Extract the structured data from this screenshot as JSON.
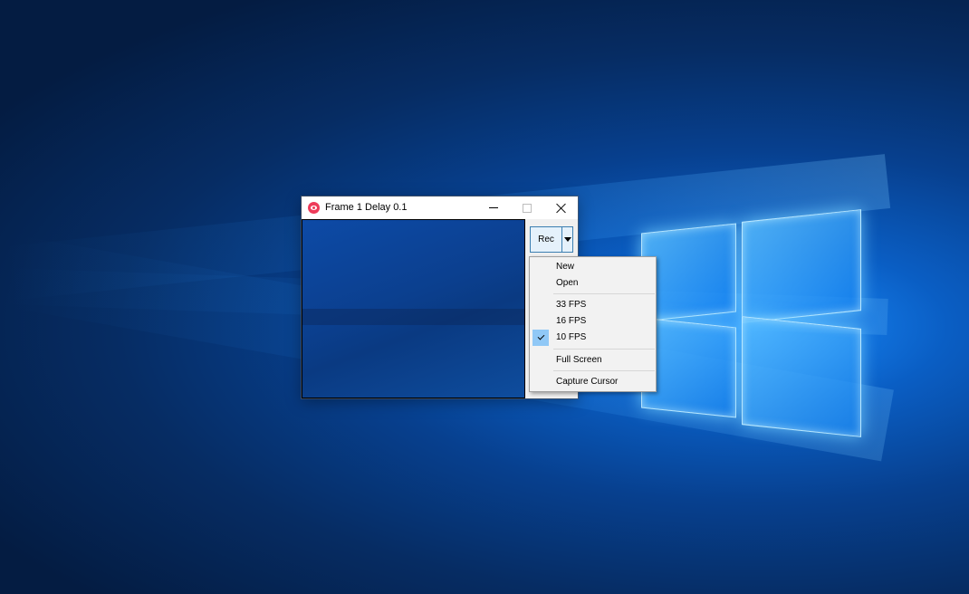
{
  "window": {
    "title": "Frame 1 Delay 0.1",
    "rec_label": "Rec"
  },
  "menu": {
    "items": [
      {
        "label": "New"
      },
      {
        "label": "Open"
      },
      {
        "label": "33 FPS"
      },
      {
        "label": "16 FPS"
      },
      {
        "label": "10 FPS",
        "checked": true
      },
      {
        "label": "Full Screen"
      },
      {
        "label": "Capture Cursor"
      }
    ]
  },
  "colors": {
    "app_icon": "#ee3b5a",
    "check_highlight": "#90c8f6",
    "rec_border": "#3c7fb1"
  },
  "icons": {
    "app": "record-icon",
    "minimize": "minimize-icon",
    "maximize": "maximize-icon",
    "close": "close-icon",
    "dropdown": "chevron-down-icon",
    "check": "checkmark-icon"
  }
}
